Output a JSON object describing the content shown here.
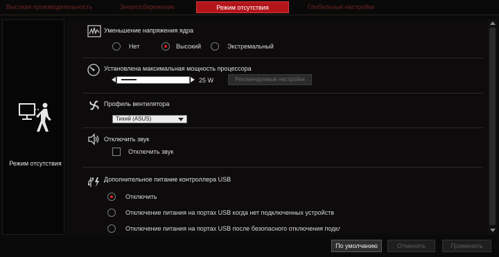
{
  "tabs": [
    {
      "label": "Высокая производительность",
      "active": false
    },
    {
      "label": "Энергосбережение",
      "active": false
    },
    {
      "label": "Режим отсутствия",
      "active": true
    },
    {
      "label": "Глобальные настройки",
      "active": false
    }
  ],
  "left_pane": {
    "label": "Режим отсутствия",
    "icon": "away-mode-icon"
  },
  "sections": {
    "voltage": {
      "title": "Уменьшение напряжения ядра",
      "icon": "voltage-chart-icon",
      "options": [
        "Нет",
        "Высокий",
        "Экстремальный"
      ],
      "selected": "Высокий"
    },
    "cpu_power": {
      "title": "Установлена максимальная мощность процессора",
      "icon": "gauge-icon",
      "value": "25 W",
      "recommended_button": "Рекомендуемые настройки"
    },
    "fan": {
      "title": "Профиль вентилятора",
      "icon": "fan-icon",
      "selected_option": "Тихий (ASUS)"
    },
    "sound": {
      "title": "Отключить звук",
      "icon": "speaker-icon",
      "checkbox_label": "Отключить звук",
      "checked": false
    },
    "usb": {
      "title": "Дополнительное питание контроллера USB",
      "icon": "usb-icon",
      "options": [
        "Отключить",
        "Отключение питания на портах USB когда нет подключенных устройств",
        "Отключение питания на портах USB после безопасного отключения подклю"
      ],
      "selected": "Отключить"
    }
  },
  "buttons": {
    "default": "По умолчанию",
    "cancel": "Отменить",
    "apply": "Применить"
  },
  "colors": {
    "accent": "#b3151b",
    "radio_dot": "#e01b22",
    "background": "#0b0a0a"
  }
}
